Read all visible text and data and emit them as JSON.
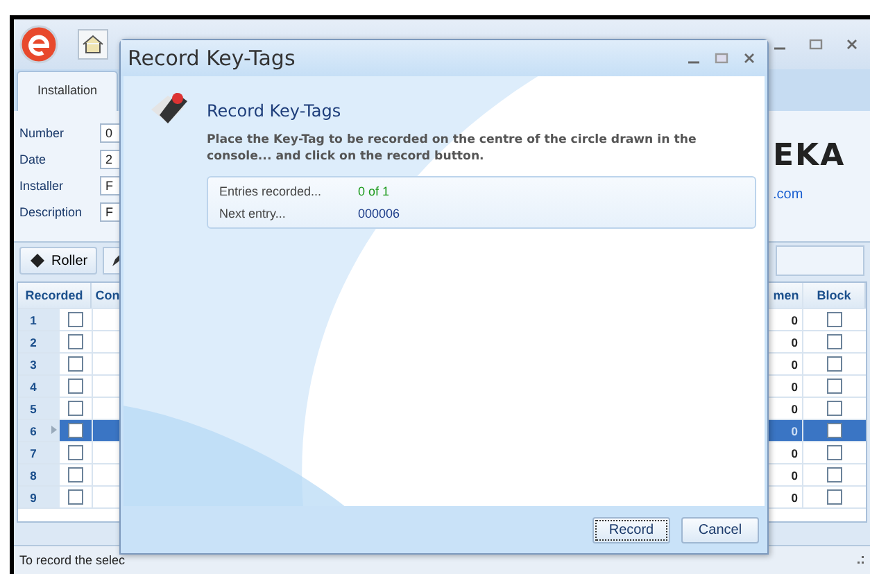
{
  "main_window": {
    "tabs": [
      {
        "label": "Installation",
        "selected": true
      }
    ],
    "form": [
      {
        "label": "Number",
        "value": "0"
      },
      {
        "label": "Date",
        "value": "2"
      },
      {
        "label": "Installer",
        "value": "F"
      },
      {
        "label": "Description",
        "value": "F"
      }
    ],
    "brand": {
      "logo_text": "EKA",
      "link": ".com"
    },
    "toolbar": [
      {
        "label": "Roller"
      }
    ],
    "grid": {
      "columns": [
        "Recorded",
        "Con",
        "men",
        "Block"
      ],
      "rows": [
        {
          "number": "1",
          "recorded": false,
          "value": "0",
          "block": false,
          "selected": false
        },
        {
          "number": "2",
          "recorded": false,
          "value": "0",
          "block": false,
          "selected": false
        },
        {
          "number": "3",
          "recorded": false,
          "value": "0",
          "block": false,
          "selected": false
        },
        {
          "number": "4",
          "recorded": false,
          "value": "0",
          "block": false,
          "selected": false
        },
        {
          "number": "5",
          "recorded": false,
          "value": "0",
          "block": false,
          "selected": false
        },
        {
          "number": "6",
          "recorded": false,
          "value": "0",
          "block": false,
          "selected": true
        },
        {
          "number": "7",
          "recorded": false,
          "value": "0",
          "block": false,
          "selected": false
        },
        {
          "number": "8",
          "recorded": false,
          "value": "0",
          "block": false,
          "selected": false
        },
        {
          "number": "9",
          "recorded": false,
          "value": "0",
          "block": false,
          "selected": false
        }
      ]
    },
    "status_bar": "To record the selec"
  },
  "dialog": {
    "title": "Record Key-Tags",
    "heading": "Record Key-Tags",
    "instruction": "Place the Key-Tag to be recorded on the centre of the circle drawn in the console... and click on the record  button.",
    "entries": [
      {
        "label": "Entries recorded...",
        "value": "0 of 1",
        "kind": "count"
      },
      {
        "label": "Next entry...",
        "value": "000006",
        "kind": "code"
      }
    ],
    "buttons": [
      {
        "label": "Record",
        "focused": true
      },
      {
        "label": "Cancel",
        "focused": false
      }
    ]
  }
}
